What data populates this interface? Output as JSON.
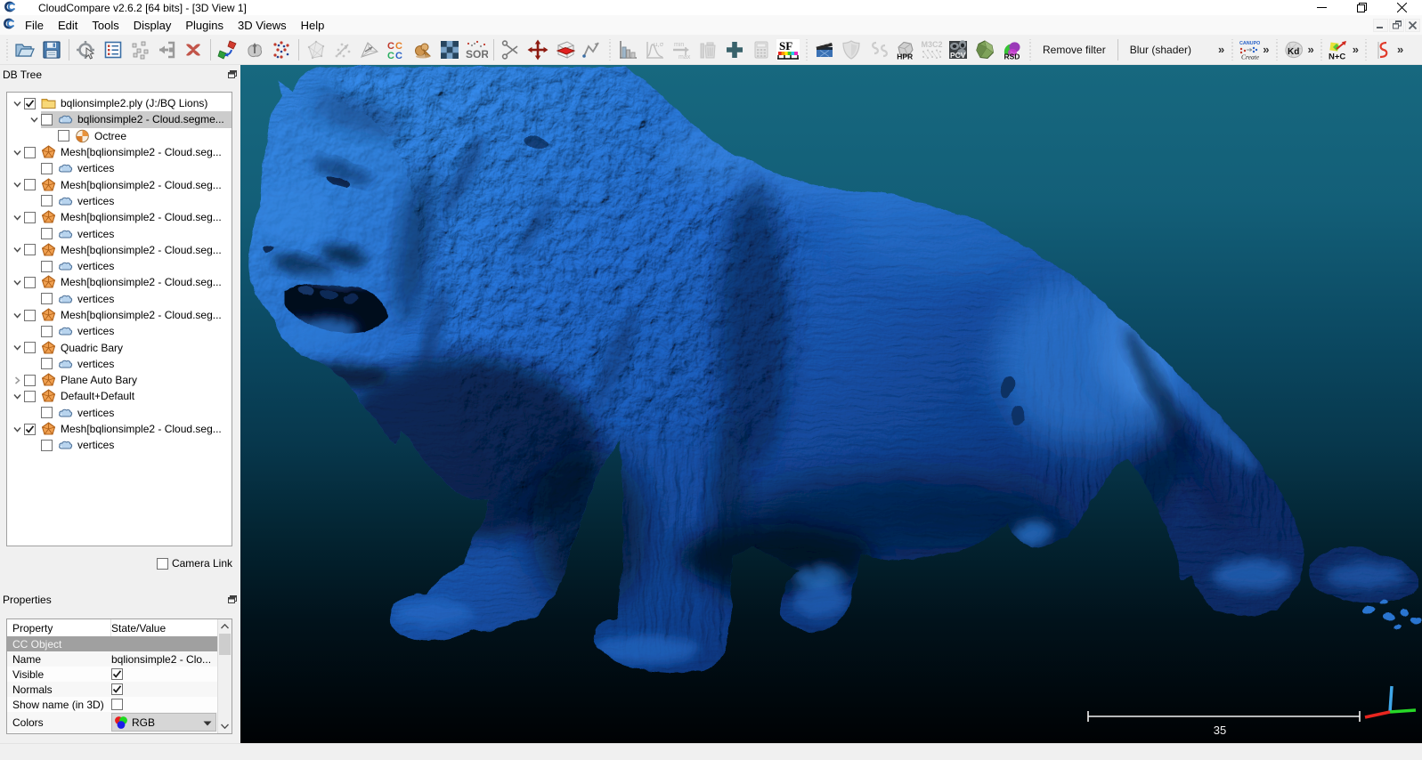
{
  "window": {
    "title": "CloudCompare v2.6.2 [64 bits] - [3D View 1]",
    "controls": [
      "minimize",
      "maximize",
      "close"
    ]
  },
  "menu": {
    "items": [
      "File",
      "Edit",
      "Tools",
      "Display",
      "Plugins",
      "3D Views",
      "Help"
    ],
    "mdi_controls": [
      "minimize",
      "restore",
      "close"
    ]
  },
  "toolbar": {
    "items": [
      {
        "kind": "handle"
      },
      {
        "kind": "icon",
        "name": "open"
      },
      {
        "kind": "icon",
        "name": "save"
      },
      {
        "kind": "sep"
      },
      {
        "kind": "icon",
        "name": "pick-rotation-center"
      },
      {
        "kind": "icon",
        "name": "properties-list"
      },
      {
        "kind": "icon",
        "name": "point-picking"
      },
      {
        "kind": "icon",
        "name": "apply-transformation"
      },
      {
        "kind": "icon",
        "name": "delete"
      },
      {
        "kind": "sep"
      },
      {
        "kind": "icon",
        "name": "clone"
      },
      {
        "kind": "icon",
        "name": "fuse"
      },
      {
        "kind": "icon",
        "name": "subsample"
      },
      {
        "kind": "sep"
      },
      {
        "kind": "icon",
        "name": "convex-hull",
        "disabled": true
      },
      {
        "kind": "icon",
        "name": "align-points",
        "disabled": true
      },
      {
        "kind": "icon",
        "name": "fine-registration"
      },
      {
        "kind": "icon",
        "name": "cloud-cloud-distance"
      },
      {
        "kind": "icon",
        "name": "sand-distance"
      },
      {
        "kind": "icon",
        "name": "checkerboard"
      },
      {
        "kind": "icon",
        "name": "sor-filter"
      },
      {
        "kind": "sep"
      },
      {
        "kind": "icon",
        "name": "scissors"
      },
      {
        "kind": "icon",
        "name": "translate-rotate"
      },
      {
        "kind": "icon",
        "name": "cross-section"
      },
      {
        "kind": "icon",
        "name": "polyline-trace"
      },
      {
        "kind": "handle"
      },
      {
        "kind": "icon",
        "name": "histogram"
      },
      {
        "kind": "icon",
        "name": "gaussian-filter",
        "disabled": true
      },
      {
        "kind": "icon",
        "name": "min-max",
        "disabled": true
      },
      {
        "kind": "icon",
        "name": "delete-sf",
        "disabled": true
      },
      {
        "kind": "icon",
        "name": "add-sf"
      },
      {
        "kind": "icon",
        "name": "sf-arithmetic",
        "disabled": true
      },
      {
        "kind": "icon",
        "name": "sf-rainbow"
      },
      {
        "kind": "handle"
      },
      {
        "kind": "icon",
        "name": "animation"
      },
      {
        "kind": "icon",
        "name": "shield",
        "disabled": true
      },
      {
        "kind": "icon",
        "name": "ss-curvature",
        "disabled": true
      },
      {
        "kind": "icon",
        "name": "hpr"
      },
      {
        "kind": "icon",
        "name": "m3c2",
        "disabled": true
      },
      {
        "kind": "icon",
        "name": "pcv"
      },
      {
        "kind": "icon",
        "name": "poisson-recon"
      },
      {
        "kind": "icon",
        "name": "rsd"
      },
      {
        "kind": "handle"
      },
      {
        "kind": "label",
        "text": "Remove filter"
      },
      {
        "kind": "sep"
      },
      {
        "kind": "label",
        "text": "Blur (shader)"
      },
      {
        "kind": "spacer",
        "w": 18
      },
      {
        "kind": "chev"
      },
      {
        "kind": "handle"
      },
      {
        "kind": "icon",
        "name": "canupo",
        "compact": true
      },
      {
        "kind": "chev"
      },
      {
        "kind": "handle"
      },
      {
        "kind": "icon",
        "name": "kd-tree",
        "compact": true
      },
      {
        "kind": "chev"
      },
      {
        "kind": "handle"
      },
      {
        "kind": "icon",
        "name": "normals-compute",
        "compact": true
      },
      {
        "kind": "chev"
      },
      {
        "kind": "handle"
      },
      {
        "kind": "icon",
        "name": "s-spline",
        "compact": true
      },
      {
        "kind": "chev"
      }
    ],
    "overflow_glyph": "»"
  },
  "db_tree": {
    "title": "DB Tree",
    "items": [
      {
        "depth": 0,
        "expander": "open",
        "checked": true,
        "icon": "folder",
        "label": "bqlionsimple2.ply (J:/BQ Lions)"
      },
      {
        "depth": 1,
        "expander": "open",
        "checked": false,
        "icon": "cloud",
        "label": "bqlionsimple2 - Cloud.segme...",
        "selected": true
      },
      {
        "depth": 2,
        "expander": "none",
        "checked": false,
        "icon": "octree",
        "label": "Octree"
      },
      {
        "depth": 0,
        "expander": "open",
        "checked": false,
        "icon": "mesh",
        "label": "Mesh[bqlionsimple2 - Cloud.seg..."
      },
      {
        "depth": 1,
        "expander": "none",
        "checked": false,
        "icon": "cloud",
        "label": "vertices"
      },
      {
        "depth": 0,
        "expander": "open",
        "checked": false,
        "icon": "mesh",
        "label": "Mesh[bqlionsimple2 - Cloud.seg..."
      },
      {
        "depth": 1,
        "expander": "none",
        "checked": false,
        "icon": "cloud",
        "label": "vertices"
      },
      {
        "depth": 0,
        "expander": "open",
        "checked": false,
        "icon": "mesh",
        "label": "Mesh[bqlionsimple2 - Cloud.seg..."
      },
      {
        "depth": 1,
        "expander": "none",
        "checked": false,
        "icon": "cloud",
        "label": "vertices"
      },
      {
        "depth": 0,
        "expander": "open",
        "checked": false,
        "icon": "mesh",
        "label": "Mesh[bqlionsimple2 - Cloud.seg..."
      },
      {
        "depth": 1,
        "expander": "none",
        "checked": false,
        "icon": "cloud",
        "label": "vertices"
      },
      {
        "depth": 0,
        "expander": "open",
        "checked": false,
        "icon": "mesh",
        "label": "Mesh[bqlionsimple2 - Cloud.seg..."
      },
      {
        "depth": 1,
        "expander": "none",
        "checked": false,
        "icon": "cloud",
        "label": "vertices"
      },
      {
        "depth": 0,
        "expander": "open",
        "checked": false,
        "icon": "mesh",
        "label": "Mesh[bqlionsimple2 - Cloud.seg..."
      },
      {
        "depth": 1,
        "expander": "none",
        "checked": false,
        "icon": "cloud",
        "label": "vertices"
      },
      {
        "depth": 0,
        "expander": "open",
        "checked": false,
        "icon": "mesh",
        "label": "Quadric Bary"
      },
      {
        "depth": 1,
        "expander": "none",
        "checked": false,
        "icon": "cloud",
        "label": "vertices"
      },
      {
        "depth": 0,
        "expander": "closed",
        "checked": false,
        "icon": "mesh",
        "label": "Plane Auto Bary"
      },
      {
        "depth": 0,
        "expander": "open",
        "checked": false,
        "icon": "mesh",
        "label": "Default+Default"
      },
      {
        "depth": 1,
        "expander": "none",
        "checked": false,
        "icon": "cloud",
        "label": "vertices"
      },
      {
        "depth": 0,
        "expander": "open",
        "checked": true,
        "icon": "mesh",
        "label": "Mesh[bqlionsimple2 - Cloud.seg..."
      },
      {
        "depth": 1,
        "expander": "none",
        "checked": false,
        "icon": "cloud",
        "label": "vertices"
      }
    ],
    "camera_link": {
      "label": "Camera Link",
      "checked": false
    }
  },
  "properties": {
    "title": "Properties",
    "columns": {
      "property": "Property",
      "value": "State/Value"
    },
    "rows": [
      {
        "type": "section",
        "label": "CC Object"
      },
      {
        "type": "text",
        "label": "Name",
        "value": "bqlionsimple2 - Clo..."
      },
      {
        "type": "check",
        "label": "Visible",
        "checked": true
      },
      {
        "type": "check",
        "label": "Normals",
        "checked": true
      },
      {
        "type": "check",
        "label": "Show name (in 3D)",
        "checked": false
      },
      {
        "type": "dropdown",
        "label": "Colors",
        "value": "RGB",
        "icon": "rgb-wheel"
      }
    ]
  },
  "viewport": {
    "scale_bar_label": "35",
    "colors": {
      "bg_top": "#17687f",
      "bg_bottom": "#000000",
      "mesh_base": "#1b64c8",
      "axis_x": "#e8261f",
      "axis_y": "#27d827",
      "axis_z": "#3fa7e8"
    }
  }
}
